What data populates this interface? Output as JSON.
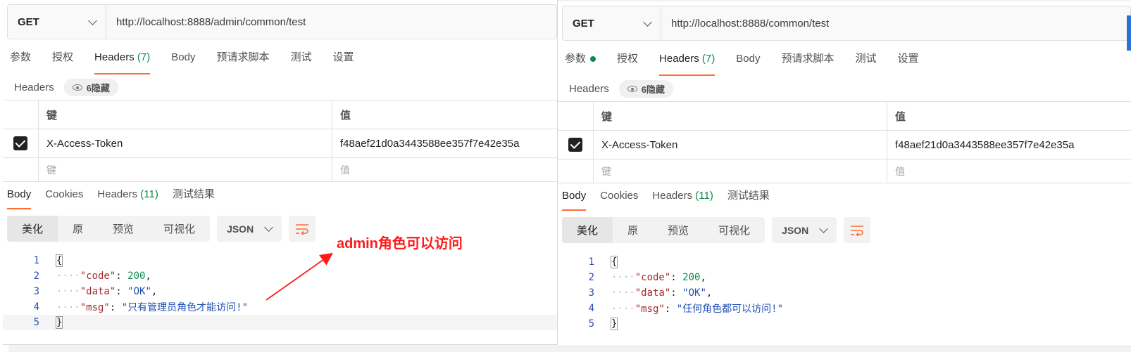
{
  "colors": {
    "accent": "#ff6c37",
    "count_green": "#0d8a4e",
    "annotation_red": "#ff1a1a"
  },
  "panels": [
    {
      "method": "GET",
      "url": "http://localhost:8888/admin/common/test",
      "tabs": [
        {
          "label": "参数"
        },
        {
          "label": "授权"
        },
        {
          "label": "Headers",
          "count": "(7)"
        },
        {
          "label": "Body"
        },
        {
          "label": "预请求脚本"
        },
        {
          "label": "测试"
        },
        {
          "label": "设置"
        }
      ],
      "headers_title": "Headers",
      "hidden_label": "6隐藏",
      "col_key": "键",
      "col_value": "值",
      "row_key": "X-Access-Token",
      "row_value": "f48aef21d0a3443588ee357f7e42e35a",
      "placeholder_key": "键",
      "placeholder_value": "值",
      "resp_tabs": [
        {
          "label": "Body"
        },
        {
          "label": "Cookies"
        },
        {
          "label": "Headers",
          "count": "(11)"
        },
        {
          "label": "测试结果"
        }
      ],
      "view_modes": [
        "美化",
        "原",
        "预览",
        "可视化"
      ],
      "format": "JSON",
      "code": {
        "code_key": "\"code\"",
        "code_val": "200",
        "data_key": "\"data\"",
        "data_val": "\"OK\"",
        "msg_key": "\"msg\"",
        "msg_val": "\"只有管理员角色才能访问!\""
      },
      "line_numbers": [
        "1",
        "2",
        "3",
        "4",
        "5"
      ]
    },
    {
      "method": "GET",
      "url": "http://localhost:8888/common/test",
      "tabs": [
        {
          "label": "参数"
        },
        {
          "label": "授权"
        },
        {
          "label": "Headers",
          "count": "(7)"
        },
        {
          "label": "Body"
        },
        {
          "label": "预请求脚本"
        },
        {
          "label": "测试"
        },
        {
          "label": "设置"
        }
      ],
      "headers_title": "Headers",
      "hidden_label": "6隐藏",
      "col_key": "键",
      "col_value": "值",
      "row_key": "X-Access-Token",
      "row_value": "f48aef21d0a3443588ee357f7e42e35a",
      "placeholder_key": "键",
      "placeholder_value": "值",
      "resp_tabs": [
        {
          "label": "Body"
        },
        {
          "label": "Cookies"
        },
        {
          "label": "Headers",
          "count": "(11)"
        },
        {
          "label": "测试结果"
        }
      ],
      "view_modes": [
        "美化",
        "原",
        "预览",
        "可视化"
      ],
      "format": "JSON",
      "code": {
        "code_key": "\"code\"",
        "code_val": "200",
        "data_key": "\"data\"",
        "data_val": "\"OK\"",
        "msg_key": "\"msg\"",
        "msg_val": "\"任何角色都可以访问!\""
      },
      "line_numbers": [
        "1",
        "2",
        "3",
        "4",
        "5"
      ]
    }
  ],
  "annotation": "admin角色可以访问"
}
